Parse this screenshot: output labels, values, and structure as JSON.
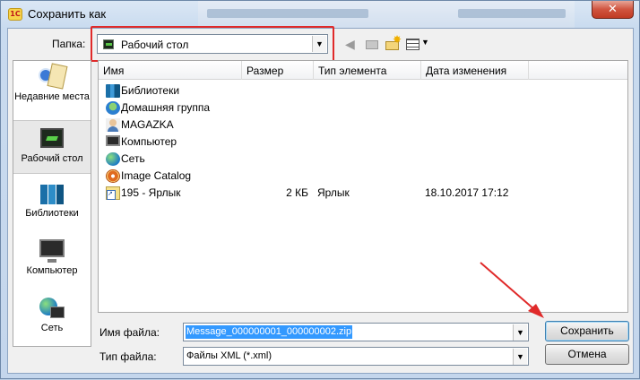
{
  "window": {
    "app_icon": "1C",
    "title": "Сохранить как",
    "close_glyph": "✕"
  },
  "toolbar": {
    "folder_label": "Папка:",
    "folder_value": "Рабочий стол",
    "icons": [
      "back-arrow-icon",
      "up-folder-icon",
      "new-folder-icon",
      "view-menu-icon"
    ]
  },
  "places": [
    {
      "label": "Недавние места",
      "icon": "recent-places-icon"
    },
    {
      "label": "Рабочий стол",
      "icon": "desktop-icon",
      "active": true
    },
    {
      "label": "Библиотеки",
      "icon": "libraries-icon"
    },
    {
      "label": "Компьютер",
      "icon": "computer-icon"
    },
    {
      "label": "Сеть",
      "icon": "network-icon"
    }
  ],
  "file_list": {
    "columns": [
      "Имя",
      "Размер",
      "Тип элемента",
      "Дата изменения"
    ],
    "rows": [
      {
        "name": "Библиотеки",
        "size": "",
        "type": "",
        "date": "",
        "icon": "libraries-icon"
      },
      {
        "name": "Домашняя группа",
        "size": "",
        "type": "",
        "date": "",
        "icon": "homegroup-icon"
      },
      {
        "name": "MAGAZKA",
        "size": "",
        "type": "",
        "date": "",
        "icon": "user-icon"
      },
      {
        "name": "Компьютер",
        "size": "",
        "type": "",
        "date": "",
        "icon": "computer-icon"
      },
      {
        "name": "Сеть",
        "size": "",
        "type": "",
        "date": "",
        "icon": "network-icon"
      },
      {
        "name": "Image Catalog",
        "size": "",
        "type": "",
        "date": "",
        "icon": "image-catalog-icon"
      },
      {
        "name": "195 - Ярлык",
        "size": "2 КБ",
        "type": "Ярлык",
        "date": "18.10.2017 17:12",
        "icon": "shortcut-icon"
      }
    ]
  },
  "form": {
    "filename_label": "Имя файла:",
    "filename_value": "Message_000000001_000000002.zip",
    "filetype_label": "Тип файла:",
    "filetype_value": "Файлы XML (*.xml)"
  },
  "buttons": {
    "save": "Сохранить",
    "cancel": "Отмена"
  },
  "colors": {
    "highlight_frame": "#e02a2a",
    "selection": "#3399ff"
  }
}
